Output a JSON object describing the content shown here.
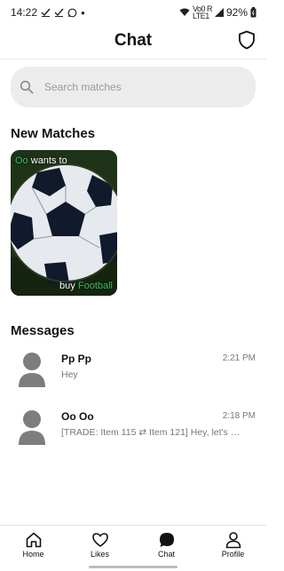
{
  "status_bar": {
    "time": "14:22",
    "battery": "92%",
    "signal_top": "Vo0 R",
    "signal_bottom": "LTE1"
  },
  "header": {
    "title": "Chat"
  },
  "search": {
    "placeholder": "Search matches",
    "value": ""
  },
  "new_matches": {
    "title": "New Matches",
    "cards": [
      {
        "name": "Oo",
        "top_text": "wants to",
        "bottom_text": "buy",
        "item": "Football"
      }
    ]
  },
  "messages": {
    "title": "Messages",
    "items": [
      {
        "name": "Pp Pp",
        "time": "2:21 PM",
        "preview": "Hey"
      },
      {
        "name": "Oo Oo",
        "time": "2:18 PM",
        "preview": "[TRADE: Item 115 ⇄ Item 121] Hey, let's …"
      }
    ]
  },
  "bottom_nav": {
    "items": [
      {
        "label": "Home",
        "icon": "home-icon",
        "active": false
      },
      {
        "label": "Likes",
        "icon": "heart-icon",
        "active": false
      },
      {
        "label": "Chat",
        "icon": "chat-icon",
        "active": true
      },
      {
        "label": "Profile",
        "icon": "profile-icon",
        "active": false
      }
    ]
  },
  "colors": {
    "accent_green": "#3bbf5f",
    "search_bg": "#ececec",
    "muted_text": "#777777"
  }
}
